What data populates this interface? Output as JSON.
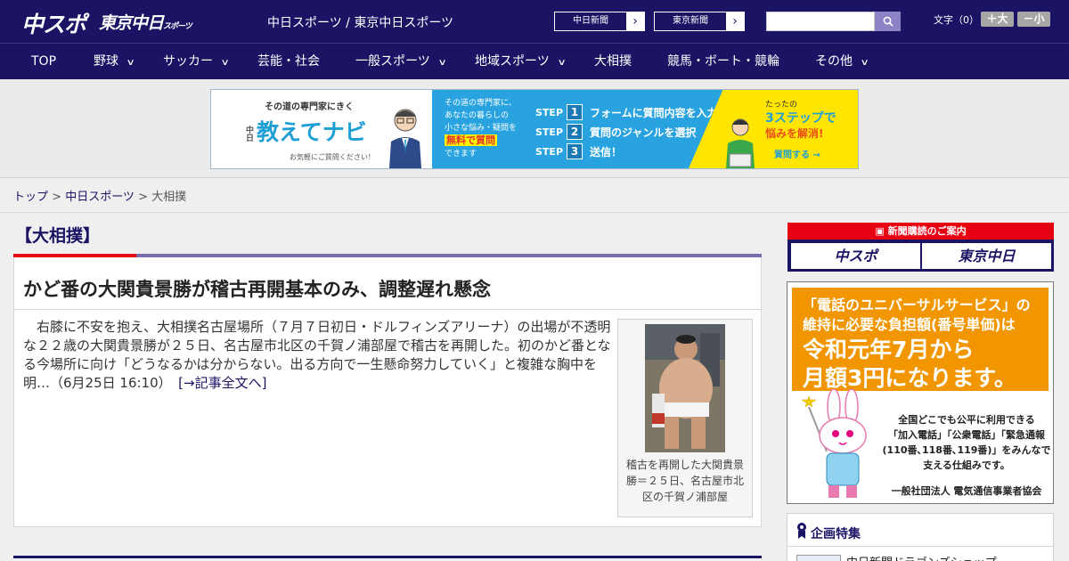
{
  "header": {
    "logo_chusupo": "中スポ",
    "logo_tokyo": "東京中日",
    "logo_tokyo_small": "スポーツ",
    "site_names": "中日スポーツ / 東京中日スポーツ",
    "link_chunichi": "中日新聞",
    "link_tokyo": "東京新聞",
    "arrow": "›",
    "font_label": "文字（0）",
    "font_bigger": "＋大",
    "font_smaller": "－小"
  },
  "nav": {
    "items": [
      {
        "label": "TOP",
        "has_menu": false
      },
      {
        "label": "野球",
        "has_menu": true
      },
      {
        "label": "サッカー",
        "has_menu": true
      },
      {
        "label": "芸能・社会",
        "has_menu": false
      },
      {
        "label": "一般スポーツ",
        "has_menu": true
      },
      {
        "label": "地域スポーツ",
        "has_menu": true
      },
      {
        "label": "大相撲",
        "has_menu": false
      },
      {
        "label": "競馬・ボート・競輪",
        "has_menu": false
      },
      {
        "label": "その他",
        "has_menu": true
      }
    ],
    "chevron": "∨"
  },
  "banner": {
    "subtitle": "その道の専門家にきく",
    "brand_small": "中日",
    "title": "教えてナビ",
    "foot": "お気軽にご質問ください！",
    "desc_1": "その道の専門家に、",
    "desc_2": "あなたの暮らしの",
    "desc_3": "小さな悩み・疑問を",
    "desc_highlight": "無料で質問",
    "desc_4": "できます",
    "step_label": "STEP",
    "steps": [
      {
        "num": "1",
        "text": "フォームに質問内容を入力"
      },
      {
        "num": "2",
        "text": "質問のジャンルを選択"
      },
      {
        "num": "3",
        "text": "送信！"
      }
    ],
    "r1": "たったの",
    "r2": "3ステップで",
    "r3": "悩みを解消!",
    "r4": "質問する →"
  },
  "breadcrumb": {
    "top": "トップ",
    "sep": " > ",
    "chunichi": "中日スポーツ",
    "current": "大相撲"
  },
  "section": {
    "title": "【大相撲】"
  },
  "article": {
    "title": "かど番の大関貴景勝が稽古再開基本のみ、調整遅れ懸念",
    "body": "右膝に不安を抱え、大相撲名古屋場所（７月７日初日・ドルフィンズアリーナ）の出場が不透明な２２歳の大関貴景勝が２５日、名古屋市北区の千賀ノ浦部屋で稽古を再開した。初のかど番となる今場所に向け「どうなるかは分からない。出る方向で一生懸命努力していく」と複雑な胸中を明…（6月25日 16:10）",
    "link": "[→記事全文へ]",
    "photo_caption": "稽古を再開した大関貴景勝＝２５日、名古屋市北区の千賀ノ浦部屋"
  },
  "sidebar": {
    "subscribe_head": "新聞購読のご案内",
    "subscribe_chusupo": "中スポ",
    "subscribe_tokyo": "東京中日",
    "ad_line1": "「電話のユニバーサルサービス」の",
    "ad_line2": "維持に必要な負担額(番号単価)は",
    "ad_line3": "令和元年7月から",
    "ad_line4": "月額3円になります。",
    "ad_body_1": "全国どこでも公平に利用できる",
    "ad_body_2": "「加入電話」「公衆電話」「緊急通報",
    "ad_body_3": "(110番､118番､119番)」をみんなで",
    "ad_body_4": "支える仕組みです。",
    "ad_org": "一般社団法人 電気通信事業者協会",
    "feature_title": "企画特集",
    "feature_item": "中日新聞ドラゴンズショップ"
  },
  "colors": {
    "header_bg": "#1b1464",
    "accent_red": "#e60012",
    "section_purple": "#7a6aae",
    "banner_blue": "#29a3df",
    "banner_yellow": "#ffe500",
    "ad_orange": "#f29600"
  }
}
